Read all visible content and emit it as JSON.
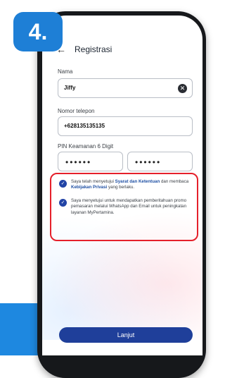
{
  "step": "4.",
  "screen_title": "Registrasi",
  "fields": {
    "name": {
      "label": "Nama",
      "value": "Jiffy"
    },
    "phone": {
      "label": "Nomor telepon",
      "value": "+628135135135"
    },
    "pin": {
      "label": "PIN Keamanan 6 Digit",
      "value": "••••••",
      "confirm_value": "••••••"
    }
  },
  "consents": [
    {
      "text_before": "Saya telah menyetujui ",
      "link1": "Syarat dan Ketentuan",
      "text_middle": " dan membaca ",
      "link2": "Kebijakan Privasi",
      "text_after": " yang berlaku."
    },
    {
      "text": "Saya menyetujui untuk mendapatkan pemberitahuan promo pemasaran melalui WhatsApp dan Email untuk peningkatan layanan MyPertamina."
    }
  ],
  "submit_label": "Lanjut",
  "colors": {
    "accent": "#1f3f9a",
    "badge": "#1e7fd6",
    "highlight": "#e5202b"
  },
  "icons": {
    "back": "arrow-left-icon",
    "clear": "clear-circle-icon",
    "check": "check-circle-icon"
  }
}
